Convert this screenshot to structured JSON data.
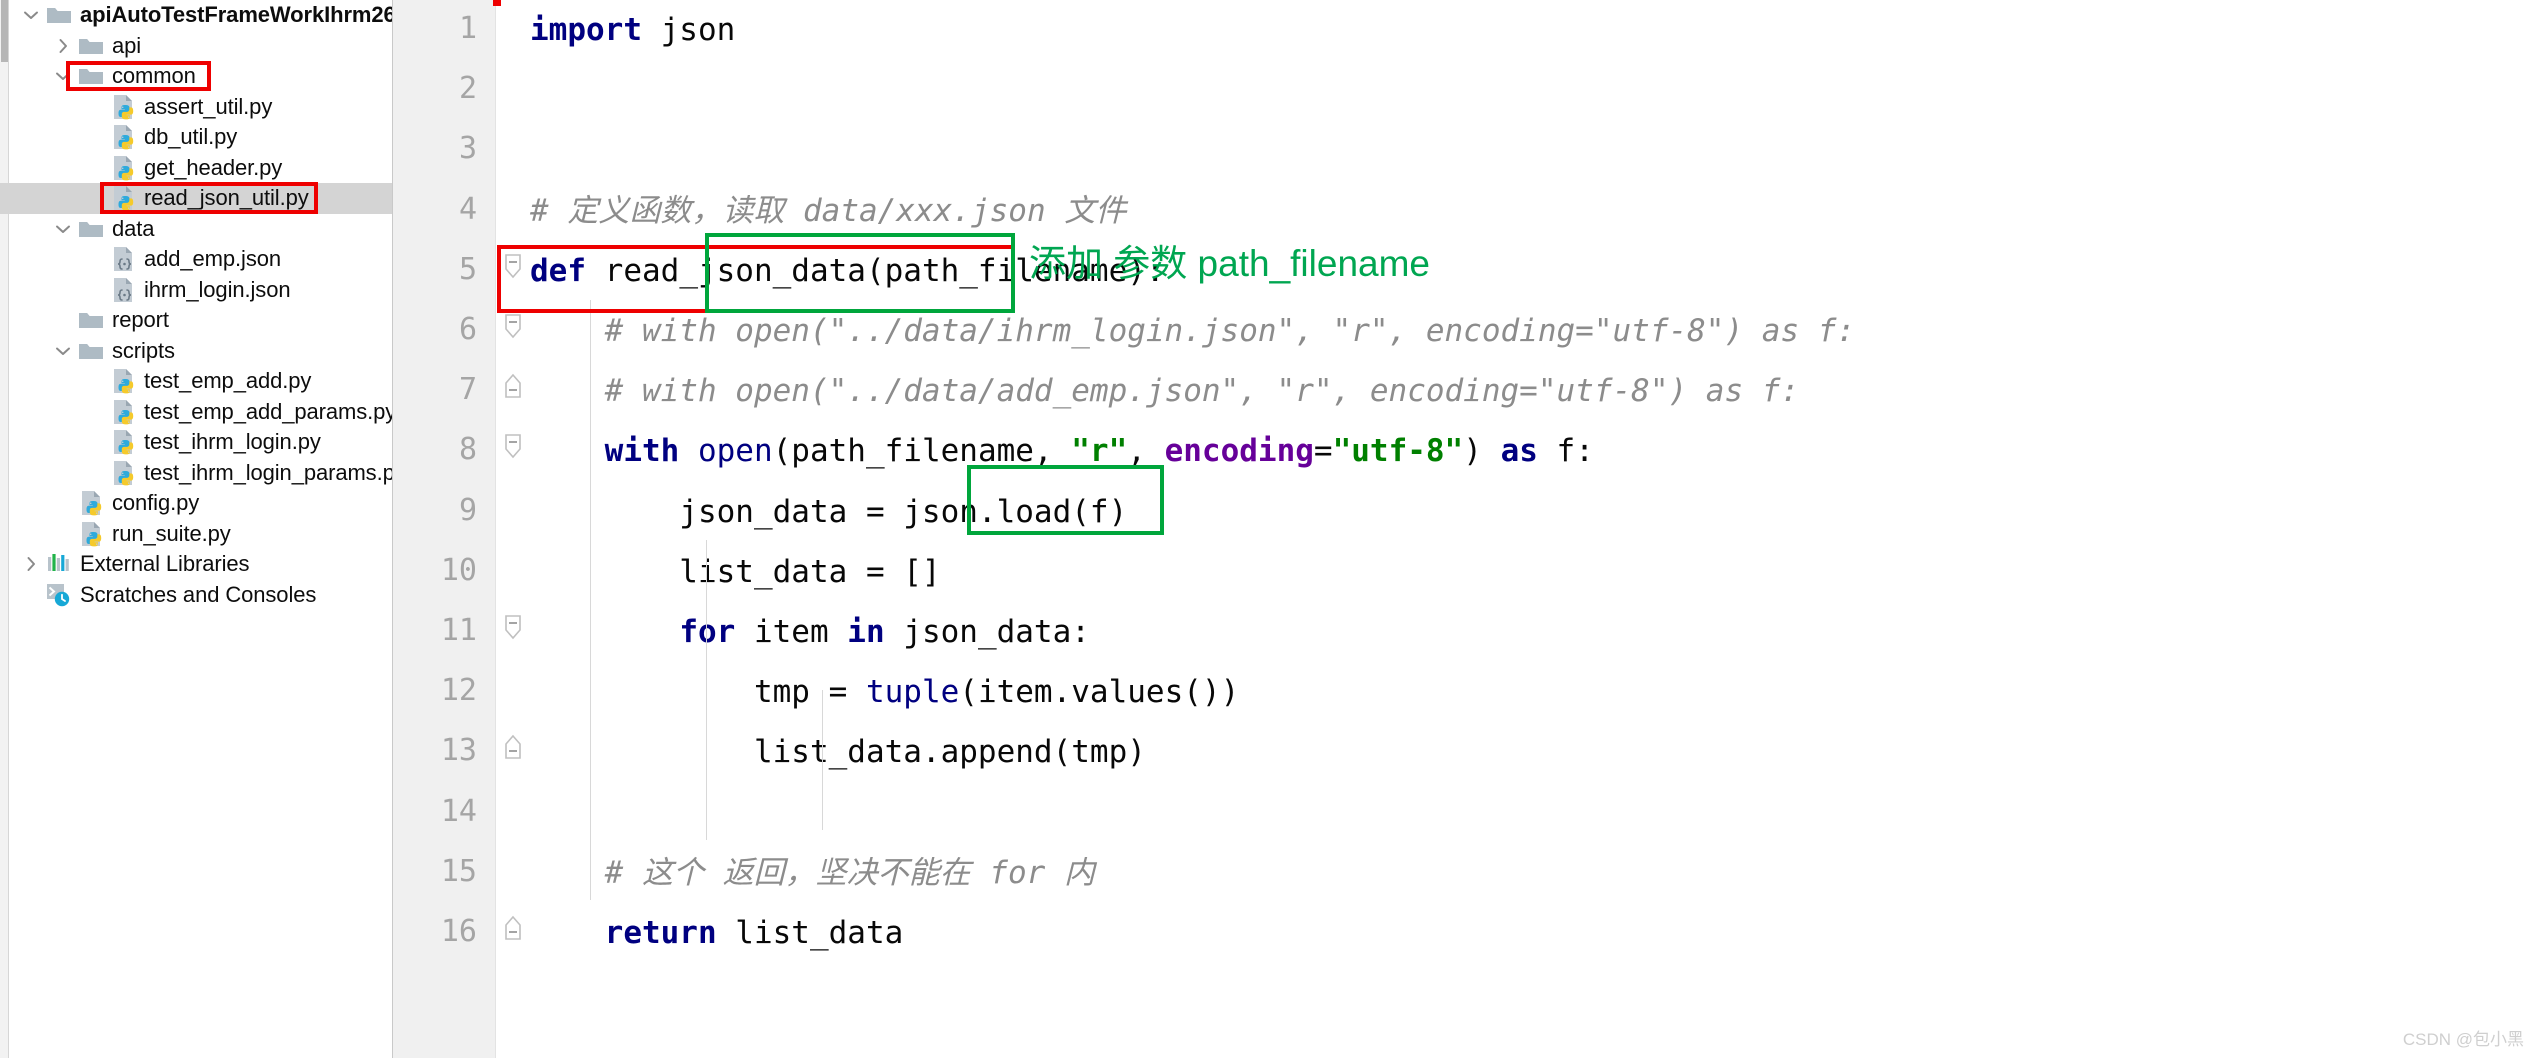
{
  "project_tree": {
    "name": "project-tree",
    "items": [
      {
        "label": "apiAutoTestFrameWorkIhrm26",
        "icon": "folder-icon",
        "twisty": "chevron-down",
        "depth": 0,
        "bold": true,
        "selected": false,
        "highlighted": false
      },
      {
        "label": "api",
        "icon": "folder-icon",
        "twisty": "chevron-right",
        "depth": 1,
        "bold": false,
        "selected": false,
        "highlighted": false
      },
      {
        "label": "common",
        "icon": "folder-icon",
        "twisty": "chevron-down",
        "depth": 1,
        "bold": false,
        "selected": false,
        "highlighted": true
      },
      {
        "label": "assert_util.py",
        "icon": "python-file-icon",
        "twisty": "none",
        "depth": 2,
        "bold": false,
        "selected": false,
        "highlighted": false
      },
      {
        "label": "db_util.py",
        "icon": "python-file-icon",
        "twisty": "none",
        "depth": 2,
        "bold": false,
        "selected": false,
        "highlighted": false
      },
      {
        "label": "get_header.py",
        "icon": "python-file-icon",
        "twisty": "none",
        "depth": 2,
        "bold": false,
        "selected": false,
        "highlighted": false
      },
      {
        "label": "read_json_util.py",
        "icon": "python-file-icon",
        "twisty": "none",
        "depth": 2,
        "bold": false,
        "selected": true,
        "highlighted": true
      },
      {
        "label": "data",
        "icon": "folder-icon",
        "twisty": "chevron-down",
        "depth": 1,
        "bold": false,
        "selected": false,
        "highlighted": false
      },
      {
        "label": "add_emp.json",
        "icon": "json-file-icon",
        "twisty": "none",
        "depth": 2,
        "bold": false,
        "selected": false,
        "highlighted": false
      },
      {
        "label": "ihrm_login.json",
        "icon": "json-file-icon",
        "twisty": "none",
        "depth": 2,
        "bold": false,
        "selected": false,
        "highlighted": false
      },
      {
        "label": "report",
        "icon": "folder-icon",
        "twisty": "none",
        "depth": 1,
        "bold": false,
        "selected": false,
        "highlighted": false
      },
      {
        "label": "scripts",
        "icon": "folder-icon",
        "twisty": "chevron-down",
        "depth": 1,
        "bold": false,
        "selected": false,
        "highlighted": false
      },
      {
        "label": "test_emp_add.py",
        "icon": "python-file-icon",
        "twisty": "none",
        "depth": 2,
        "bold": false,
        "selected": false,
        "highlighted": false
      },
      {
        "label": "test_emp_add_params.py",
        "icon": "python-file-icon",
        "twisty": "none",
        "depth": 2,
        "bold": false,
        "selected": false,
        "highlighted": false
      },
      {
        "label": "test_ihrm_login.py",
        "icon": "python-file-icon",
        "twisty": "none",
        "depth": 2,
        "bold": false,
        "selected": false,
        "highlighted": false
      },
      {
        "label": "test_ihrm_login_params.py",
        "icon": "python-file-icon",
        "twisty": "none",
        "depth": 2,
        "bold": false,
        "selected": false,
        "highlighted": false
      },
      {
        "label": "config.py",
        "icon": "python-file-icon",
        "twisty": "none",
        "depth": 1,
        "bold": false,
        "selected": false,
        "highlighted": false
      },
      {
        "label": "run_suite.py",
        "icon": "python-file-icon",
        "twisty": "none",
        "depth": 1,
        "bold": false,
        "selected": false,
        "highlighted": false
      },
      {
        "label": "External Libraries",
        "icon": "library-icon",
        "twisty": "chevron-right",
        "depth": 0,
        "bold": false,
        "selected": false,
        "highlighted": false
      },
      {
        "label": "Scratches and Consoles",
        "icon": "scratches-icon",
        "twisty": "none",
        "depth": 0,
        "bold": false,
        "selected": false,
        "highlighted": false
      }
    ]
  },
  "editor": {
    "line_numbers": [
      "1",
      "2",
      "3",
      "4",
      "5",
      "6",
      "7",
      "8",
      "9",
      "10",
      "11",
      "12",
      "13",
      "14",
      "15",
      "16"
    ],
    "lines": [
      {
        "n": 1,
        "tokens": [
          {
            "t": "import",
            "c": "kw"
          },
          {
            "t": " json",
            "c": "plain"
          }
        ]
      },
      {
        "n": 2,
        "tokens": []
      },
      {
        "n": 3,
        "tokens": []
      },
      {
        "n": 4,
        "tokens": [
          {
            "t": "# 定义函数，读取 data/xxx.json 文件",
            "c": "cmt"
          }
        ]
      },
      {
        "n": 5,
        "tokens": [
          {
            "t": "def",
            "c": "kw"
          },
          {
            "t": " read_json_data(path_filename):",
            "c": "plain"
          }
        ]
      },
      {
        "n": 6,
        "tokens": [
          {
            "t": "    # with open(\"../data/ihrm_login.json\", \"r\", encoding=\"utf-8\") as f:",
            "c": "cmt"
          }
        ]
      },
      {
        "n": 7,
        "tokens": [
          {
            "t": "    # with open(\"../data/add_emp.json\", \"r\", encoding=\"utf-8\") as f:",
            "c": "cmt"
          }
        ]
      },
      {
        "n": 8,
        "tokens": [
          {
            "t": "    ",
            "c": "plain"
          },
          {
            "t": "with",
            "c": "kw"
          },
          {
            "t": " ",
            "c": "plain"
          },
          {
            "t": "open",
            "c": "builtin"
          },
          {
            "t": "(path_filename, ",
            "c": "plain"
          },
          {
            "t": "\"r\"",
            "c": "str"
          },
          {
            "t": ", ",
            "c": "plain"
          },
          {
            "t": "encoding",
            "c": "parm"
          },
          {
            "t": "=",
            "c": "plain"
          },
          {
            "t": "\"utf-8\"",
            "c": "str"
          },
          {
            "t": ") ",
            "c": "plain"
          },
          {
            "t": "as",
            "c": "kw"
          },
          {
            "t": " f:",
            "c": "plain"
          }
        ]
      },
      {
        "n": 9,
        "tokens": [
          {
            "t": "        json_data = json.load(f)",
            "c": "plain"
          }
        ]
      },
      {
        "n": 10,
        "tokens": [
          {
            "t": "        list_data = []",
            "c": "plain"
          }
        ]
      },
      {
        "n": 11,
        "tokens": [
          {
            "t": "        ",
            "c": "plain"
          },
          {
            "t": "for",
            "c": "kw"
          },
          {
            "t": " item ",
            "c": "plain"
          },
          {
            "t": "in",
            "c": "kw"
          },
          {
            "t": " json_data:",
            "c": "plain"
          }
        ]
      },
      {
        "n": 12,
        "tokens": [
          {
            "t": "            tmp = ",
            "c": "plain"
          },
          {
            "t": "tuple",
            "c": "builtin"
          },
          {
            "t": "(item.values())",
            "c": "plain"
          }
        ]
      },
      {
        "n": 13,
        "tokens": [
          {
            "t": "            list_data.append(tmp)",
            "c": "plain"
          }
        ]
      },
      {
        "n": 14,
        "tokens": []
      },
      {
        "n": 15,
        "tokens": [
          {
            "t": "    # 这个 返回，坚决不能在 for 内",
            "c": "cmt"
          }
        ]
      },
      {
        "n": 16,
        "tokens": [
          {
            "t": "    ",
            "c": "plain"
          },
          {
            "t": "return",
            "c": "kw"
          },
          {
            "t": " list_data",
            "c": "plain"
          }
        ]
      }
    ]
  },
  "annotations": {
    "green_note": "添加 参数 path_filename",
    "colors": {
      "red_box": "#ee0000",
      "green_box": "#00a63c",
      "green_text": "#00a651"
    }
  },
  "watermark": "CSDN @包小黑"
}
